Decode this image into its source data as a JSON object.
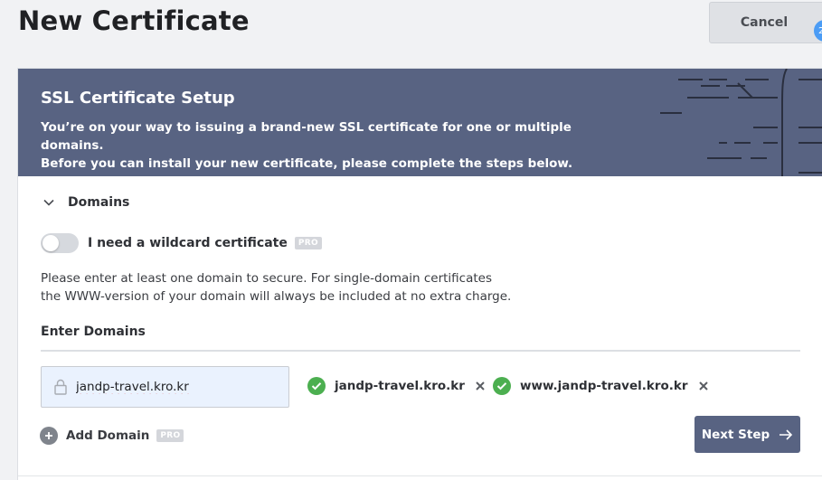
{
  "page": {
    "title": "New Certificate",
    "cancel_label": "Cancel",
    "notification_count": "2"
  },
  "banner": {
    "title": "SSL Certificate Setup",
    "line1": "You’re on your way to issuing a brand-new SSL certificate for one or multiple domains.",
    "line2": "Before you can install your new certificate, please complete the steps below.",
    "bg_color": "#586382"
  },
  "domains_section": {
    "title": "Domains",
    "wildcard_label": "I need a wildcard certificate",
    "wildcard_enabled": false,
    "pro_badge": "PRO",
    "info_line1": "Please enter at least one domain to secure. For single-domain certificates",
    "info_line2": "the WWW-version of your domain will always be included at no extra charge.",
    "enter_label": "Enter Domains",
    "input_value": "jandp-travel.kro.kr",
    "domains": [
      {
        "name": "jandp-travel.kro.kr",
        "icon": "check-circle-icon"
      },
      {
        "name": "www.jandp-travel.kro.kr",
        "icon": "check-circle-icon"
      }
    ],
    "add_domain_label": "Add Domain",
    "next_step_label": "Next Step"
  },
  "colors": {
    "accent": "#586382",
    "success": "#4caf50",
    "badge": "#4b9cf5"
  }
}
